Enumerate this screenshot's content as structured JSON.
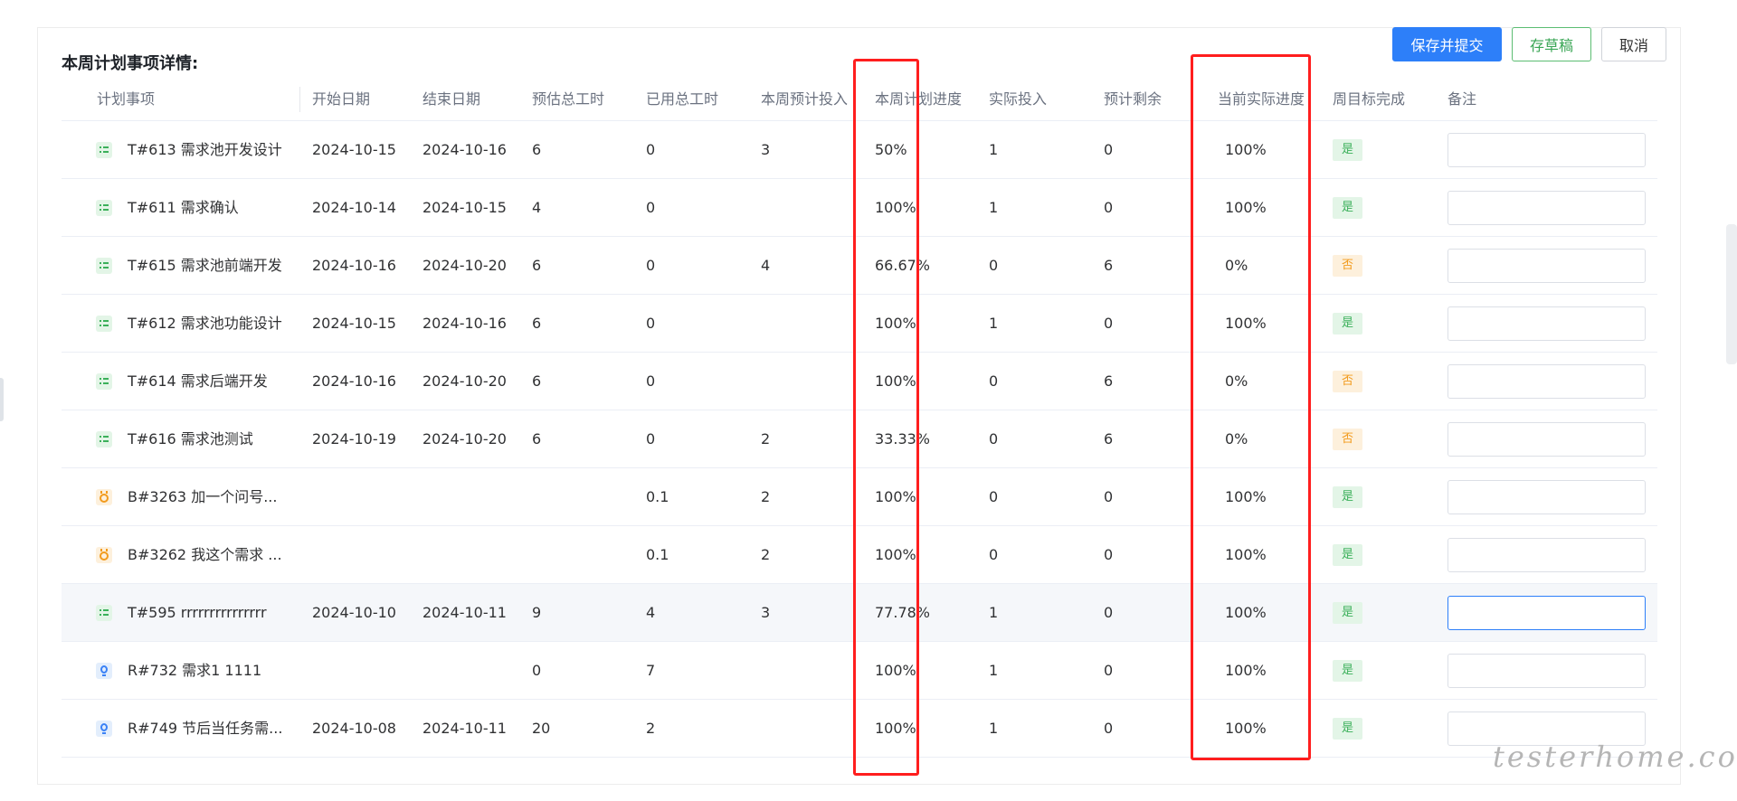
{
  "title": "本周计划事项详情:",
  "buttons": {
    "submit": "保存并提交",
    "draft": "存草稿",
    "cancel": "取消"
  },
  "columns": [
    "计划事项",
    "开始日期",
    "结束日期",
    "预估总工时",
    "已用总工时",
    "本周预计投入",
    "本周计划进度",
    "实际投入",
    "预计剩余",
    "当前实际进度",
    "周目标完成",
    "备注"
  ],
  "rows": [
    {
      "icon": "task-icon",
      "name": "T#613 需求池开发设计",
      "start": "2024-10-15",
      "end": "2024-10-16",
      "est": "6",
      "used": "0",
      "week_plan": "3",
      "plan_progress": "50%",
      "actual": "1",
      "remain": "0",
      "actual_progress": "100%",
      "done": "是",
      "done_state": "yes",
      "remark": ""
    },
    {
      "icon": "task-icon",
      "name": "T#611 需求确认",
      "start": "2024-10-14",
      "end": "2024-10-15",
      "est": "4",
      "used": "0",
      "week_plan": "",
      "plan_progress": "100%",
      "actual": "1",
      "remain": "0",
      "actual_progress": "100%",
      "done": "是",
      "done_state": "yes",
      "remark": ""
    },
    {
      "icon": "task-icon",
      "name": "T#615 需求池前端开发",
      "start": "2024-10-16",
      "end": "2024-10-20",
      "est": "6",
      "used": "0",
      "week_plan": "4",
      "plan_progress": "66.67%",
      "actual": "0",
      "remain": "6",
      "actual_progress": "0%",
      "done": "否",
      "done_state": "no",
      "remark": ""
    },
    {
      "icon": "task-icon",
      "name": "T#612 需求池功能设计",
      "start": "2024-10-15",
      "end": "2024-10-16",
      "est": "6",
      "used": "0",
      "week_plan": "",
      "plan_progress": "100%",
      "actual": "1",
      "remain": "0",
      "actual_progress": "100%",
      "done": "是",
      "done_state": "yes",
      "remark": ""
    },
    {
      "icon": "task-icon",
      "name": "T#614 需求后端开发",
      "start": "2024-10-16",
      "end": "2024-10-20",
      "est": "6",
      "used": "0",
      "week_plan": "",
      "plan_progress": "100%",
      "actual": "0",
      "remain": "6",
      "actual_progress": "0%",
      "done": "否",
      "done_state": "no",
      "remark": ""
    },
    {
      "icon": "task-icon",
      "name": "T#616 需求池测试",
      "start": "2024-10-19",
      "end": "2024-10-20",
      "est": "6",
      "used": "0",
      "week_plan": "2",
      "plan_progress": "33.33%",
      "actual": "0",
      "remain": "6",
      "actual_progress": "0%",
      "done": "否",
      "done_state": "no",
      "remark": ""
    },
    {
      "icon": "bug-icon",
      "name": "B#3263 加一个问号...",
      "start": "",
      "end": "",
      "est": "",
      "used": "0.1",
      "week_plan": "2",
      "plan_progress": "100%",
      "actual": "0",
      "remain": "0",
      "actual_progress": "100%",
      "done": "是",
      "done_state": "yes",
      "remark": ""
    },
    {
      "icon": "bug-icon",
      "name": "B#3262 我这个需求 ...",
      "start": "",
      "end": "",
      "est": "",
      "used": "0.1",
      "week_plan": "2",
      "plan_progress": "100%",
      "actual": "0",
      "remain": "0",
      "actual_progress": "100%",
      "done": "是",
      "done_state": "yes",
      "remark": ""
    },
    {
      "icon": "task-icon",
      "name": "T#595 rrrrrrrrrrrrrrr",
      "start": "2024-10-10",
      "end": "2024-10-11",
      "est": "9",
      "used": "4",
      "week_plan": "3",
      "plan_progress": "77.78%",
      "actual": "1",
      "remain": "0",
      "actual_progress": "100%",
      "done": "是",
      "done_state": "yes",
      "remark": ""
    },
    {
      "icon": "requirement-icon",
      "name": "R#732 需求1 1111",
      "start": "",
      "end": "",
      "est": "0",
      "used": "7",
      "week_plan": "",
      "plan_progress": "100%",
      "actual": "1",
      "remain": "0",
      "actual_progress": "100%",
      "done": "是",
      "done_state": "yes",
      "remark": ""
    },
    {
      "icon": "requirement-icon",
      "name": "R#749 节后当任务需...",
      "start": "2024-10-08",
      "end": "2024-10-11",
      "est": "20",
      "used": "2",
      "week_plan": "",
      "plan_progress": "100%",
      "actual": "1",
      "remain": "0",
      "actual_progress": "100%",
      "done": "是",
      "done_state": "yes",
      "remark": ""
    }
  ],
  "colors": {
    "primary": "#2d7ff9",
    "success": "#3bb05a",
    "warning": "#f29b1d",
    "highlight_box": "#ff1e1e"
  },
  "watermark": "testerhome.com"
}
